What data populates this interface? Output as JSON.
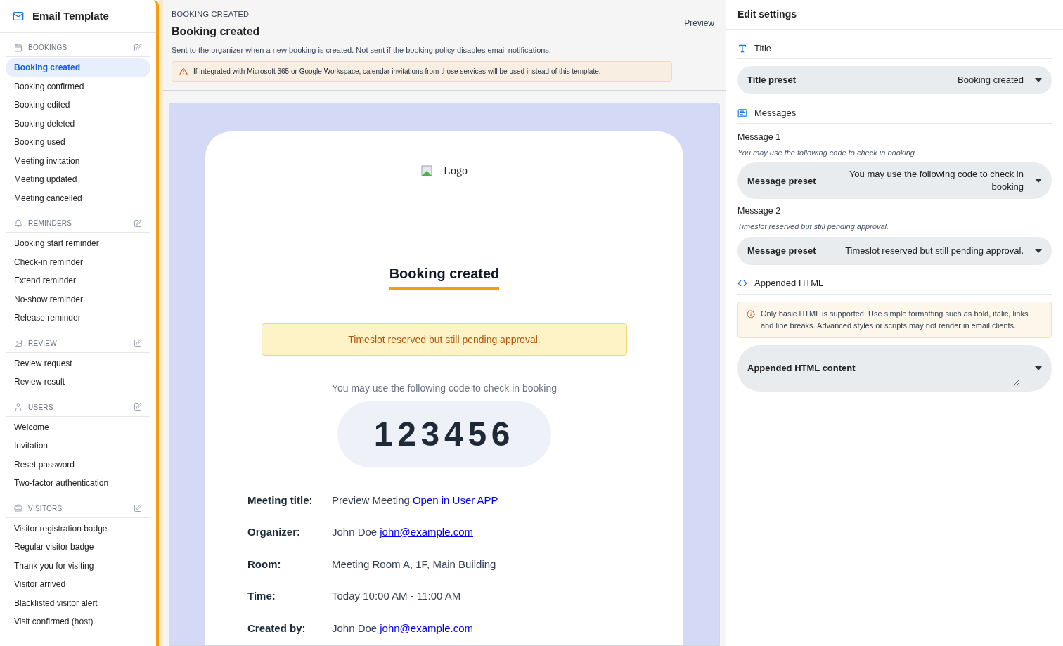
{
  "sidebar": {
    "title": "Email Template",
    "sections": [
      {
        "kind": "calendar",
        "heading": "BOOKINGS",
        "items": [
          {
            "label": "Booking created",
            "selected": true
          },
          {
            "label": "Booking confirmed",
            "selected": false
          },
          {
            "label": "Booking edited",
            "selected": false
          },
          {
            "label": "Booking deleted",
            "selected": false
          },
          {
            "label": "Booking used",
            "selected": false
          },
          {
            "label": "Meeting invitation",
            "selected": false
          },
          {
            "label": "Meeting updated",
            "selected": false
          },
          {
            "label": "Meeting cancelled",
            "selected": false
          }
        ]
      },
      {
        "kind": "bell",
        "heading": "REMINDERS",
        "items": [
          {
            "label": "Booking start reminder",
            "selected": false
          },
          {
            "label": "Check-in reminder",
            "selected": false
          },
          {
            "label": "Extend reminder",
            "selected": false
          },
          {
            "label": "No-show reminder",
            "selected": false
          },
          {
            "label": "Release reminder",
            "selected": false
          }
        ]
      },
      {
        "kind": "review",
        "heading": "REVIEW",
        "items": [
          {
            "label": "Review request",
            "selected": false
          },
          {
            "label": "Review result",
            "selected": false
          }
        ]
      },
      {
        "kind": "user",
        "heading": "USERS",
        "items": [
          {
            "label": "Welcome",
            "selected": false
          },
          {
            "label": "Invitation",
            "selected": false
          },
          {
            "label": "Reset password",
            "selected": false
          },
          {
            "label": "Two-factor authentication",
            "selected": false
          }
        ]
      },
      {
        "kind": "visitor",
        "heading": "VISITORS",
        "items": [
          {
            "label": "Visitor registration badge",
            "selected": false
          },
          {
            "label": "Regular visitor badge",
            "selected": false
          },
          {
            "label": "Thank you for visiting",
            "selected": false
          },
          {
            "label": "Visitor arrived",
            "selected": false
          },
          {
            "label": "Blacklisted visitor alert",
            "selected": false
          },
          {
            "label": "Visit confirmed (host)",
            "selected": false
          }
        ]
      }
    ]
  },
  "header": {
    "eyebrow": "BOOKING CREATED",
    "title": "Booking created",
    "description": "Sent to the organizer when a new booking is created. Not sent if the booking policy disables email notifications.",
    "warning": "If integrated with Microsoft 365 or Google Workspace, calendar invitations from those services will be used instead of this template.",
    "preview": "Preview"
  },
  "email": {
    "logo": "Logo",
    "title": "Booking created",
    "notice": "Timeslot reserved but still pending approval.",
    "code_intro": "You may use the following code to check in booking",
    "code": "123456",
    "details": [
      {
        "label": "Meeting title:",
        "value": "Preview Meeting",
        "link": "Open in User APP"
      },
      {
        "label": "Organizer:",
        "value": "John Doe",
        "link": "john@example.com"
      },
      {
        "label": "Room:",
        "value": "Meeting Room A, 1F, Main Building"
      },
      {
        "label": "Time:",
        "value": "Today 10:00 AM - 11:00 AM"
      },
      {
        "label": "Created by:",
        "value": "John Doe",
        "link": "john@example.com"
      }
    ]
  },
  "settings": {
    "title": "Edit settings",
    "sections": [
      {
        "kind": "title",
        "heading": "Title",
        "fields": [
          {
            "label": "Title preset",
            "value": "Booking created"
          }
        ]
      },
      {
        "kind": "messages",
        "heading": "Messages",
        "fields": [
          {
            "caption": "Message 1",
            "hint": "You may use the following code to check in booking",
            "label": "Message preset",
            "value": "You may use the following code to check in booking"
          },
          {
            "caption": "Message 2",
            "hint": "Timeslot reserved but still pending approval.",
            "label": "Message preset",
            "value": "Timeslot reserved but still pending approval."
          }
        ]
      },
      {
        "kind": "html",
        "heading": "Appended HTML",
        "info": "Only basic HTML is supported. Use simple formatting such as bold, italic, links and line breaks. Advanced styles or scripts may not render in email clients.",
        "fields": [
          {
            "label": "Appended HTML content",
            "kind": "textarea"
          }
        ]
      }
    ]
  }
}
